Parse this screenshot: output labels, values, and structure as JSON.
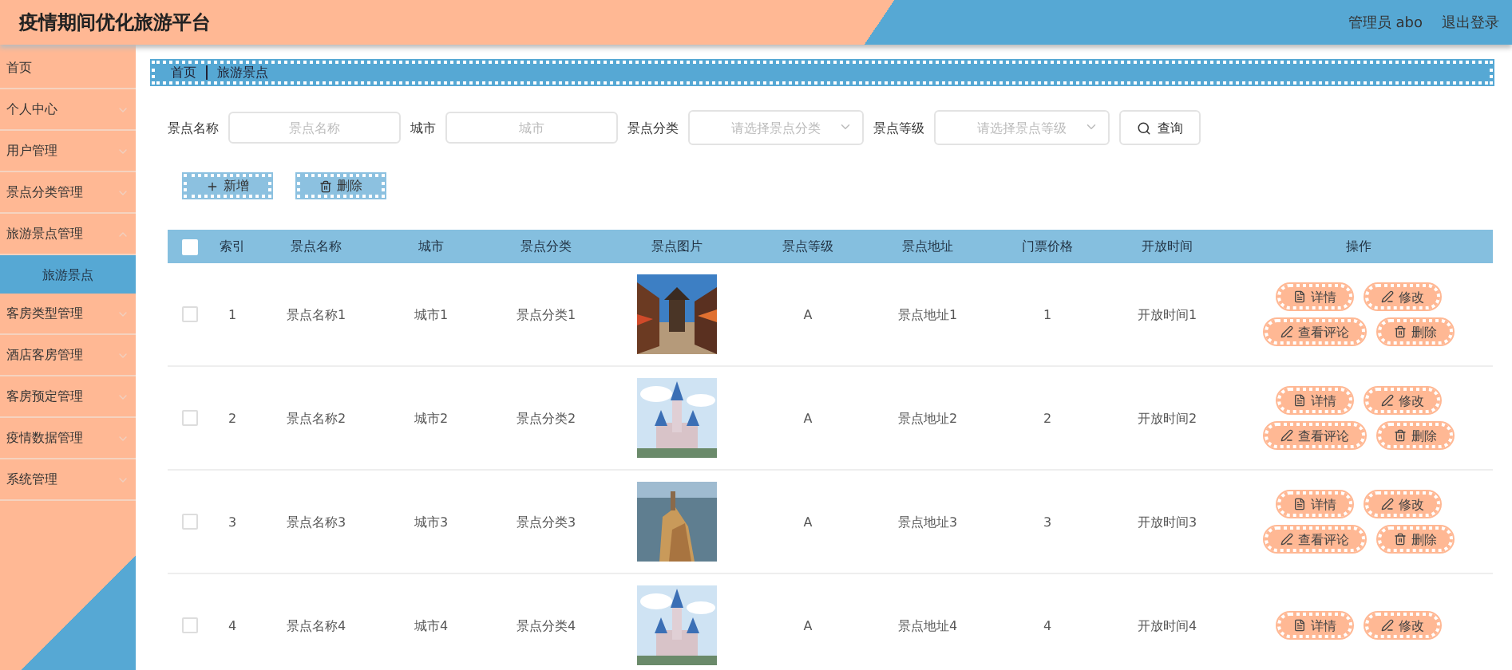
{
  "header": {
    "title": "疫情期间优化旅游平台",
    "user": "管理员 abo",
    "logout": "退出登录"
  },
  "sidebar": {
    "items": [
      {
        "kind": "link",
        "label": "首页"
      },
      {
        "kind": "menu",
        "label": "个人中心"
      },
      {
        "kind": "menu",
        "label": "用户管理"
      },
      {
        "kind": "menu",
        "label": "景点分类管理"
      },
      {
        "kind": "menu",
        "label": "旅游景点管理",
        "children": [
          {
            "label": "旅游景点",
            "selected": true
          }
        ]
      },
      {
        "kind": "menu",
        "label": "客房类型管理"
      },
      {
        "kind": "menu",
        "label": "酒店客房管理"
      },
      {
        "kind": "menu",
        "label": "客房预定管理"
      },
      {
        "kind": "menu",
        "label": "疫情数据管理"
      },
      {
        "kind": "menu",
        "label": "系统管理"
      }
    ]
  },
  "breadcrumb": [
    "首页",
    "旅游景点"
  ],
  "filters": [
    {
      "kind": "text",
      "label": "景点名称",
      "placeholder": "景点名称"
    },
    {
      "kind": "text",
      "label": "城市",
      "placeholder": "城市"
    },
    {
      "kind": "select",
      "label": "景点分类",
      "placeholder": "请选择景点分类"
    },
    {
      "kind": "select",
      "label": "景点等级",
      "placeholder": "请选择景点等级"
    }
  ],
  "search_button": "查询",
  "actions": [
    {
      "kind": "add",
      "label": "新增"
    },
    {
      "kind": "delete",
      "label": "删除"
    }
  ],
  "table": {
    "all_checked": false,
    "columns": [
      "索引",
      "景点名称",
      "城市",
      "景点分类",
      "景点图片",
      "景点等级",
      "景点地址",
      "门票价格",
      "开放时间",
      "操作"
    ],
    "rows": [
      {
        "checked": false,
        "cells": [
          "1",
          "景点名称1",
          "城市1",
          "景点分类1"
        ],
        "cells_after": [
          "A",
          "景点地址1",
          "1",
          "开放时间1"
        ],
        "buttons": [
          {
            "kind": "detail",
            "label": "详情"
          },
          {
            "kind": "edit",
            "label": "修改"
          },
          {
            "kind": "edit",
            "label": "查看评论"
          },
          {
            "kind": "delete",
            "label": "删除"
          }
        ]
      },
      {
        "checked": false,
        "cells": [
          "2",
          "景点名称2",
          "城市2",
          "景点分类2"
        ],
        "cells_after": [
          "A",
          "景点地址2",
          "2",
          "开放时间2"
        ],
        "buttons": [
          {
            "kind": "detail",
            "label": "详情"
          },
          {
            "kind": "edit",
            "label": "修改"
          },
          {
            "kind": "edit",
            "label": "查看评论"
          },
          {
            "kind": "delete",
            "label": "删除"
          }
        ]
      },
      {
        "checked": false,
        "cells": [
          "3",
          "景点名称3",
          "城市3",
          "景点分类3"
        ],
        "cells_after": [
          "A",
          "景点地址3",
          "3",
          "开放时间3"
        ],
        "buttons": [
          {
            "kind": "detail",
            "label": "详情"
          },
          {
            "kind": "edit",
            "label": "修改"
          },
          {
            "kind": "edit",
            "label": "查看评论"
          },
          {
            "kind": "delete",
            "label": "删除"
          }
        ]
      },
      {
        "checked": false,
        "cells": [
          "4",
          "景点名称4",
          "城市4",
          "景点分类4"
        ],
        "cells_after": [
          "A",
          "景点地址4",
          "4",
          "开放时间4"
        ],
        "buttons": [
          {
            "kind": "detail",
            "label": "详情"
          },
          {
            "kind": "edit",
            "label": "修改"
          }
        ]
      }
    ]
  }
}
